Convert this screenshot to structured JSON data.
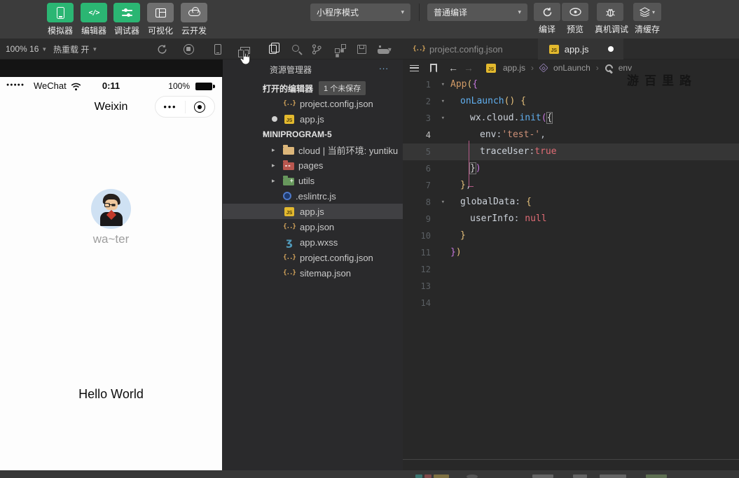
{
  "toolbar": {
    "mode_buttons": [
      {
        "label": "模拟器",
        "icon": "phone",
        "active": true
      },
      {
        "label": "编辑器",
        "icon": "code",
        "active": true
      },
      {
        "label": "调试器",
        "icon": "tune",
        "active": true
      },
      {
        "label": "可视化",
        "icon": "grid",
        "active": false
      },
      {
        "label": "云开发",
        "icon": "cloud",
        "active": false
      }
    ],
    "mode_dropdown": "小程序模式",
    "compile_dropdown": "普通编译",
    "actions": [
      {
        "label": "编译",
        "icon": "refresh"
      },
      {
        "label": "预览",
        "icon": "eye"
      },
      {
        "label": "真机调试",
        "icon": "bug"
      },
      {
        "label": "清缓存",
        "icon": "layers"
      }
    ],
    "colors": {
      "active_green": "#2bb673",
      "inactive_gray": "#6f6f6f"
    }
  },
  "sim_toolbar": {
    "zoom_label": "100% 16",
    "hot_reload_label": "热重载 开"
  },
  "tabs": [
    {
      "label": "project.config.json",
      "icon": "braces",
      "active": false,
      "dirty": false
    },
    {
      "label": "app.js",
      "icon": "js",
      "active": true,
      "dirty": true
    }
  ],
  "breadcrumb": {
    "file": "app.js",
    "scope": "onLaunch",
    "symbol": "env"
  },
  "explorer": {
    "title": "资源管理器",
    "menu": "...",
    "open_editors": {
      "label": "打开的编辑器",
      "badge": "1 个未保存",
      "items": [
        {
          "name": "project.config.json",
          "icon": "braces",
          "dirty": false
        },
        {
          "name": "app.js",
          "icon": "js",
          "dirty": true
        }
      ]
    },
    "project": {
      "label": "MINIPROGRAM-5",
      "items": [
        {
          "name": "cloud | 当前环境: yuntiku",
          "icon": "folder-cloud",
          "expandable": true,
          "selected": false
        },
        {
          "name": "pages",
          "icon": "folder-pages",
          "expandable": true,
          "selected": false
        },
        {
          "name": "utils",
          "icon": "folder-utils",
          "expandable": true,
          "selected": false
        },
        {
          "name": ".eslintrc.js",
          "icon": "eslint",
          "expandable": false,
          "selected": false
        },
        {
          "name": "app.js",
          "icon": "js",
          "expandable": false,
          "selected": true
        },
        {
          "name": "app.json",
          "icon": "braces",
          "expandable": false,
          "selected": false
        },
        {
          "name": "app.wxss",
          "icon": "wxss",
          "expandable": false,
          "selected": false
        },
        {
          "name": "project.config.json",
          "icon": "braces",
          "expandable": false,
          "selected": false
        },
        {
          "name": "sitemap.json",
          "icon": "braces",
          "expandable": false,
          "selected": false
        }
      ]
    }
  },
  "editor": {
    "watermark": "游百里路",
    "active_line": 4,
    "total_lines": 14,
    "code_lines": [
      {
        "num": 1,
        "indent": 0,
        "fold": true,
        "tokens": [
          [
            "App",
            "ent"
          ],
          [
            "(",
            "p1"
          ],
          [
            "{",
            "p2"
          ]
        ]
      },
      {
        "num": 2,
        "indent": 1,
        "fold": true,
        "tokens": [
          [
            "onLaunch",
            "fn"
          ],
          [
            "()",
            "p1"
          ],
          [
            " ",
            "pl"
          ],
          [
            "{",
            "p1"
          ]
        ]
      },
      {
        "num": 3,
        "indent": 2,
        "fold": true,
        "tokens": [
          [
            "wx",
            "var"
          ],
          [
            ".",
            "pl"
          ],
          [
            "cloud",
            "var"
          ],
          [
            ".",
            "pl"
          ],
          [
            "init",
            "fn"
          ],
          [
            "(",
            "p2"
          ],
          [
            "{",
            "match"
          ]
        ]
      },
      {
        "num": 4,
        "indent": 3,
        "active": true,
        "tokens": [
          [
            "env",
            "var"
          ],
          [
            ":",
            "pl"
          ],
          [
            "'test-'",
            "str"
          ],
          [
            ",",
            "pl"
          ]
        ]
      },
      {
        "num": 5,
        "indent": 3,
        "tokens": [
          [
            "traceUser",
            "var"
          ],
          [
            ":",
            "pl"
          ],
          [
            "true",
            "lit"
          ]
        ]
      },
      {
        "num": 6,
        "indent": 2,
        "tokens": [
          [
            "}",
            "match"
          ],
          [
            ")",
            "p2"
          ]
        ]
      },
      {
        "num": 7,
        "indent": 1,
        "tokens": [
          [
            "}",
            "p1"
          ],
          [
            ",",
            "pl"
          ]
        ]
      },
      {
        "num": 8,
        "indent": 1,
        "fold": true,
        "tokens": [
          [
            "globalData",
            "var"
          ],
          [
            ":",
            "pl"
          ],
          [
            " ",
            "pl"
          ],
          [
            "{",
            "p1"
          ]
        ]
      },
      {
        "num": 9,
        "indent": 2,
        "tokens": [
          [
            "userInfo",
            "var"
          ],
          [
            ":",
            "pl"
          ],
          [
            " ",
            "pl"
          ],
          [
            "null",
            "lit"
          ]
        ]
      },
      {
        "num": 10,
        "indent": 1,
        "tokens": [
          [
            "}",
            "p1"
          ]
        ]
      },
      {
        "num": 11,
        "indent": 0,
        "tokens": [
          [
            "}",
            "p2"
          ],
          [
            ")",
            "p1"
          ]
        ]
      },
      {
        "num": 12,
        "indent": 0,
        "tokens": []
      },
      {
        "num": 13,
        "indent": 0,
        "tokens": []
      },
      {
        "num": 14,
        "indent": 0,
        "tokens": []
      }
    ]
  },
  "simulator": {
    "carrier": "WeChat",
    "time": "0:11",
    "battery": "100%",
    "nav_title": "Weixin",
    "more_dots": "●●●",
    "signal_dots": "●●●●●",
    "nickname": "wa~ter",
    "body_text": "Hello World"
  }
}
